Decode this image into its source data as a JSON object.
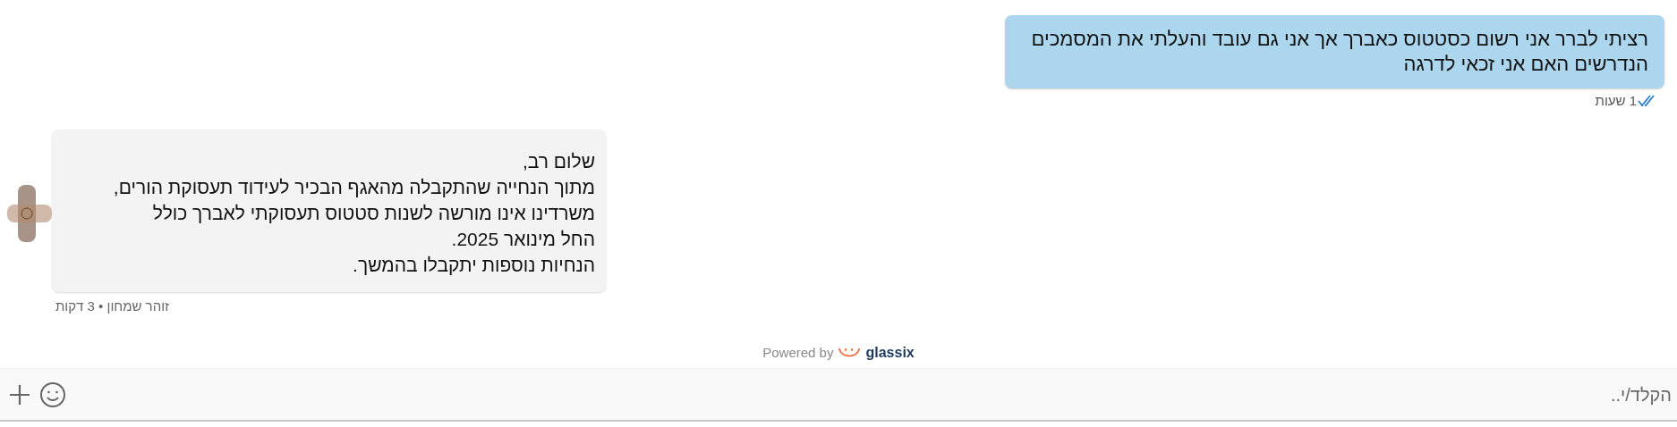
{
  "messages": [
    {
      "kind": "outgoing",
      "lines": [
        "רציתי לברר אני רשום כסטטוס כאברך אך אני גם עובד והעלתי את המסמכים",
        "הנדרשים האם אני זכאי לדרגה"
      ],
      "time": "1 שעות",
      "read": true
    },
    {
      "kind": "incoming",
      "lines": [
        "שלום רב,",
        "מתוך הנחייה שהתקבלה מהאגף הבכיר לעידוד תעסוקת הורים,",
        "משרדינו אינו מורשה לשנות סטטוס תעסוקתי לאברך כולל",
        "החל מינואר 2025.",
        "הנחיות נוספות יתקבלו בהמשך."
      ],
      "meta": "זוהר שמחון • 3 דקות"
    }
  ],
  "powered_by": {
    "label": "Powered by",
    "brand": "glassix"
  },
  "composer": {
    "placeholder": "הקלד/י.."
  }
}
